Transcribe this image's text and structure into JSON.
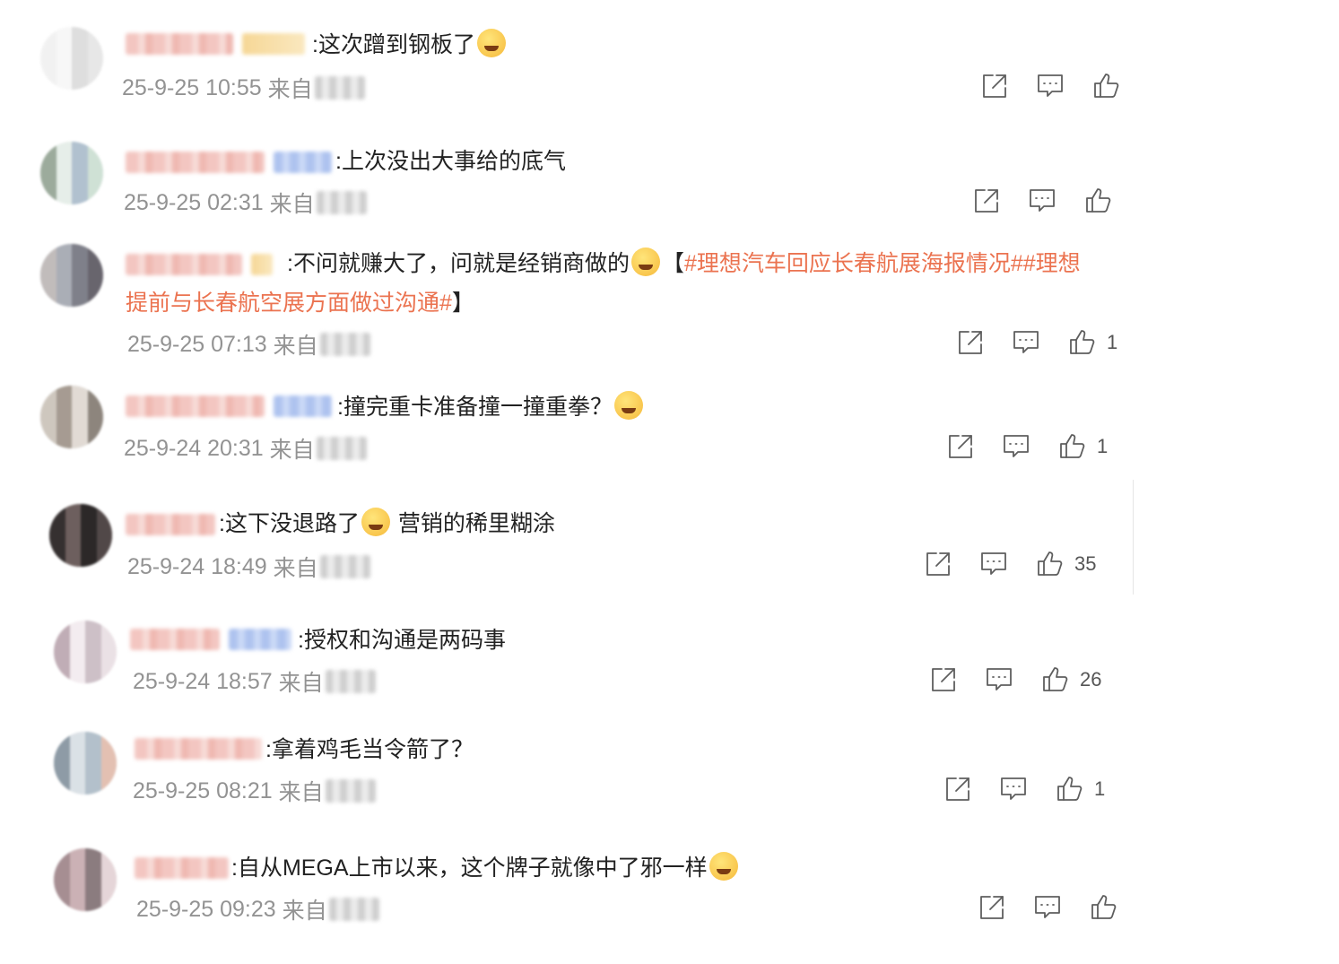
{
  "colors": {
    "topic": "#eb7350",
    "meta": "#939393",
    "text": "#222222",
    "icon": "#5e5e5e"
  },
  "icons": {
    "share": "share-icon",
    "comment": "comment-icon",
    "like": "thumbs-up-icon"
  },
  "comments": [
    {
      "text": ":这次蹭到钢板了",
      "emoji": "laugh-cry-emoji",
      "time": "25-9-25 10:55",
      "from": "来自",
      "likes": ""
    },
    {
      "text": ":上次没出大事给的底气",
      "time": "25-9-25 02:31",
      "from": "来自",
      "likes": ""
    },
    {
      "text": ":不问就赚大了，问就是经销商做的",
      "emoji": "angry-emoji",
      "bracket_open": "【",
      "topic": "#理想汽车回应长春航展海报情况##理想",
      "topic2": "提前与长春航空展方面做过沟通#",
      "bracket_close": "】",
      "time": "25-9-25 07:13",
      "from": "来自",
      "likes": "1"
    },
    {
      "text": ":撞完重卡准备撞一撞重拳？",
      "emoji": "thinking-emoji",
      "time": "25-9-24 20:31",
      "from": "来自",
      "likes": "1"
    },
    {
      "text": ":这下没退路了",
      "emoji": "grin-emoji",
      "text2": " 营销的稀里糊涂",
      "time": "25-9-24 18:49",
      "from": "来自",
      "likes": "35"
    },
    {
      "text": ":授权和沟通是两码事",
      "time": "25-9-24 18:57",
      "from": "来自",
      "likes": "26"
    },
    {
      "text": ":拿着鸡毛当令箭了？",
      "time": "25-9-25 08:21",
      "from": "来自",
      "likes": "1"
    },
    {
      "text": ":自从MEGA上市以来，这个牌子就像中了邪一样",
      "emoji": "laugh-cry-emoji",
      "time": "25-9-25 09:23",
      "from": "来自",
      "likes": ""
    }
  ]
}
